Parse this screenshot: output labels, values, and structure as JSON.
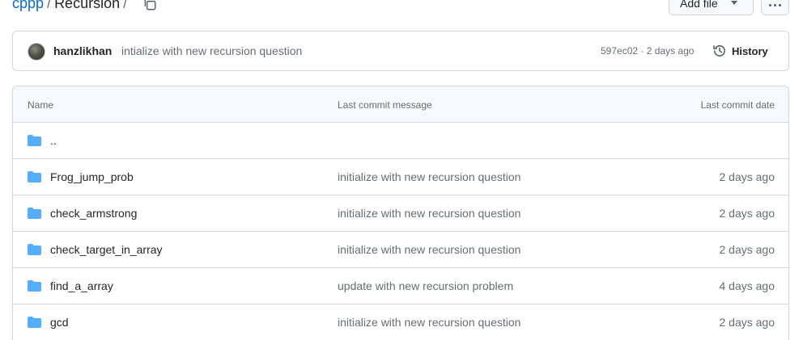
{
  "breadcrumb": {
    "repo": "cppp",
    "separator": "/",
    "current": "Recursion",
    "trailing": "/"
  },
  "buttons": {
    "add_file": "Add file"
  },
  "latest_commit": {
    "author": "hanzlikhan",
    "message": "intialize with new recursion question",
    "meta": "597ec02 · 2 days ago",
    "history_label": "History"
  },
  "table": {
    "headers": {
      "name": "Name",
      "message": "Last commit message",
      "date": "Last commit date"
    },
    "parent_dir": "..",
    "rows": [
      {
        "name": "Frog_jump_prob",
        "message": "initialize with new recursion question",
        "date": "2 days ago"
      },
      {
        "name": "check_armstrong",
        "message": "initialize with new recursion question",
        "date": "2 days ago"
      },
      {
        "name": "check_target_in_array",
        "message": "initialize with new recursion question",
        "date": "2 days ago"
      },
      {
        "name": "find_a_array",
        "message": "update with new recursion problem",
        "date": "4 days ago"
      },
      {
        "name": "gcd",
        "message": "initialize with new recursion question",
        "date": "2 days ago"
      }
    ]
  },
  "colors": {
    "link": "#0969da",
    "folder": "#54aeff",
    "muted": "#656d76",
    "border": "#d0d7de"
  },
  "icons": [
    "copy-path-icon",
    "caret-down-icon",
    "kebab-horizontal-icon",
    "history-icon",
    "folder-icon"
  ]
}
